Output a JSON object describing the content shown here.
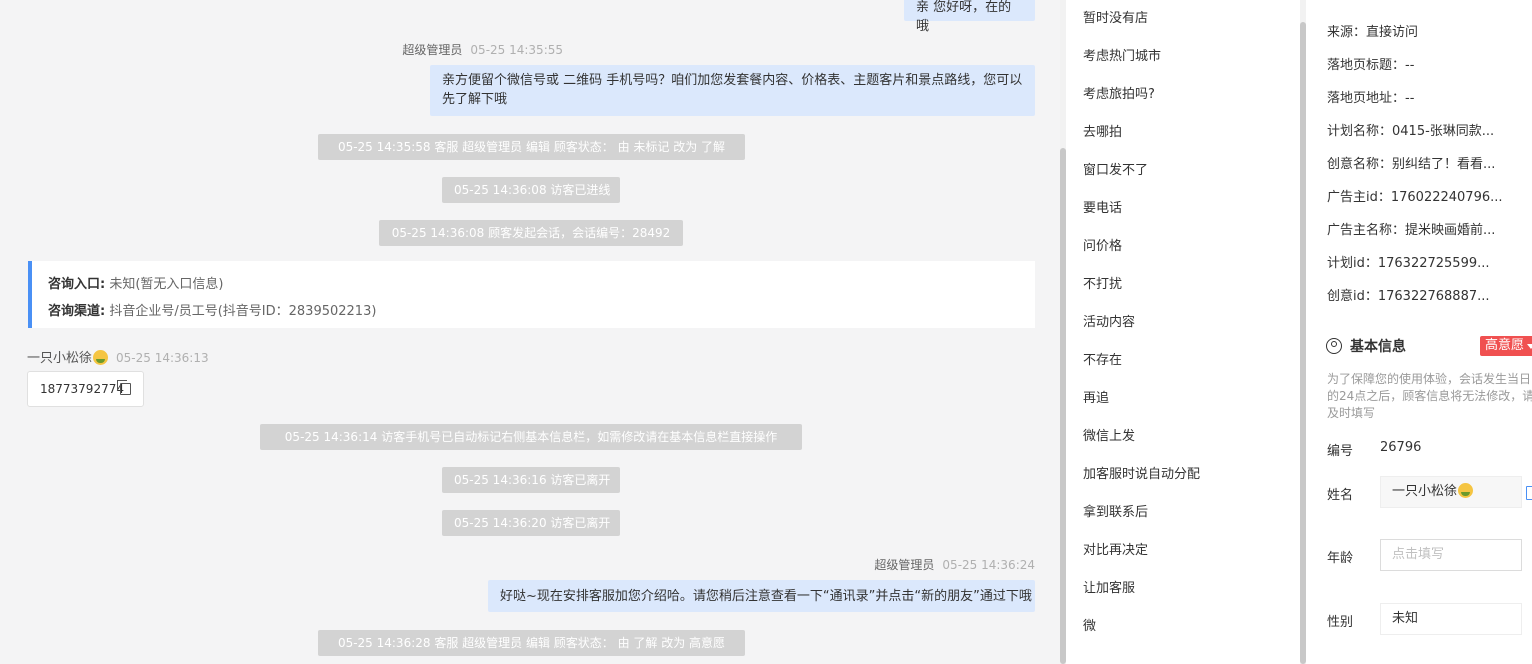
{
  "chat": {
    "top_bubble": "亲 您好呀，在的哦",
    "msg1": {
      "sender": "超级管理员",
      "time": "05-25 14:35:55",
      "text": "亲方便留个微信号或 二维码 手机号吗？咱们加您发套餐内容、价格表、主题客片和景点路线，您可以先了解下哦"
    },
    "sys1": "05-25 14:35:58 客服 超级管理员 编辑 顾客状态： 由 未标记 改为 了解",
    "sys2": "05-25 14:36:08 访客已进线",
    "sys3": "05-25 14:36:08 顾客发起会话，会话编号：28492",
    "entry_label": "咨询入口:",
    "entry_value": "未知(暂无入口信息)",
    "channel_label": "咨询渠道:",
    "channel_value": "抖音企业号/员工号(抖音号ID：2839502213)",
    "visitor_name": "一只小松徐",
    "visitor_time": "05-25 14:36:13",
    "visitor_phone": "18773792774",
    "sys4": "05-25 14:36:14 访客手机号已自动标记右侧基本信息栏，如需修改请在基本信息栏直接操作",
    "sys5": "05-25 14:36:16 访客已离开",
    "sys6": "05-25 14:36:20 访客已离开",
    "msg2": {
      "sender": "超级管理员",
      "time": "05-25 14:36:24",
      "text": "好哒~现在安排客服加您介绍哈。请您稍后注意查看一下“通讯录”并点击“新的朋友”通过下哦"
    },
    "sys7": "05-25 14:36:28 客服 超级管理员 编辑 顾客状态： 由 了解 改为 高意愿"
  },
  "phrases": [
    "暂时没有店",
    "考虑热门城市",
    "考虑旅拍吗?",
    "去哪拍",
    "窗口发不了",
    "要电话",
    "问价格",
    "不打扰",
    "活动内容",
    "不存在",
    "再追",
    "微信上发",
    "加客服时说自动分配",
    "拿到联系后",
    "对比再决定",
    "让加客服",
    "微"
  ],
  "right": {
    "lines": [
      "来源：直接访问",
      "落地页标题：--",
      "落地页地址：--",
      "计划名称：0415-张琳同款...",
      "创意名称：别纠结了！看看...",
      "广告主id：176022240796...",
      "广告主名称：提米映画婚前...",
      "计划id：176322725599...",
      "创意id：176322768887..."
    ],
    "basic_title": "基本信息",
    "intent": "高意愿",
    "hint": "为了保障您的使用体验，会话发生当日的24点之后，顾客信息将无法修改，请及时填写",
    "id_label": "编号",
    "id_value": "26796",
    "name_label": "姓名",
    "name_value": "一只小松徐",
    "age_label": "年龄",
    "age_placeholder": "点击填写",
    "gender_label": "性别",
    "gender_value": "未知"
  }
}
